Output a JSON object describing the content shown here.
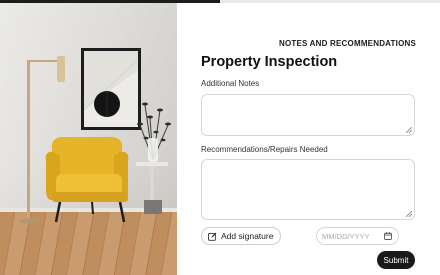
{
  "progress": {
    "value": 0.5
  },
  "photo": {
    "description_icon": "living-room-photo"
  },
  "form": {
    "section_label": "NOTES AND RECOMMENDATIONS",
    "title": "Property Inspection",
    "notes": {
      "label": "Additional Notes",
      "value": ""
    },
    "recommendations": {
      "label": "Recommendations/Repairs Needed",
      "value": ""
    },
    "signature_button": {
      "label": "Add signature",
      "icon": "edit-icon"
    },
    "date": {
      "placeholder": "MM/DD/YYYY",
      "icon": "calendar-icon"
    },
    "submit_label": "Submit"
  },
  "colors": {
    "accent": "#1a1a1a",
    "chair": "#e6b428",
    "floor": "#c08d5f"
  }
}
